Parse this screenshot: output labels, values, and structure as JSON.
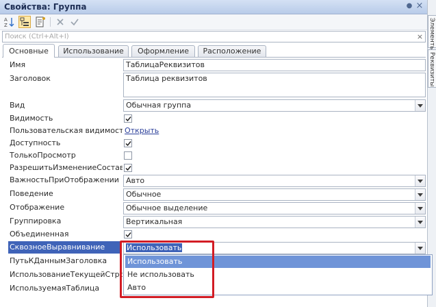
{
  "window": {
    "title": "Свойства: Группа"
  },
  "search": {
    "placeholder": "Поиск (Ctrl+Alt+I)",
    "value": ""
  },
  "tabs": [
    {
      "label": "Основные",
      "active": true
    },
    {
      "label": "Использование",
      "active": false
    },
    {
      "label": "Оформление",
      "active": false
    },
    {
      "label": "Расположение",
      "active": false
    }
  ],
  "props": {
    "name": {
      "label": "Имя",
      "value": "ТаблицаРеквизитов"
    },
    "caption": {
      "label": "Заголовок",
      "value": "Таблица реквизитов"
    },
    "view": {
      "label": "Вид",
      "value": "Обычная группа"
    },
    "visible": {
      "label": "Видимость",
      "checked": true
    },
    "user_visible": {
      "label": "Пользовательская видимость",
      "link": "Открыть"
    },
    "enabled": {
      "label": "Доступность",
      "checked": true
    },
    "readonly": {
      "label": "ТолькоПросмотр",
      "checked": false
    },
    "allow_change": {
      "label": "РазрешитьИзменениеСостава",
      "checked": true
    },
    "importance": {
      "label": "ВажностьПриОтображении",
      "value": "Авто"
    },
    "behavior": {
      "label": "Поведение",
      "value": "Обычное"
    },
    "display": {
      "label": "Отображение",
      "value": "Обычное выделение"
    },
    "grouping": {
      "label": "Группировка",
      "value": "Вертикальная"
    },
    "united": {
      "label": "Объединенная",
      "checked": true
    },
    "through_align": {
      "label": "СквозноеВыравнивание",
      "value": "Использовать"
    },
    "header_path": {
      "label": "ПутьКДаннымЗаголовка"
    },
    "use_current_row": {
      "label": "ИспользованиеТекущейСтроки"
    },
    "used_table": {
      "label": "ИспользуемаяТаблица"
    }
  },
  "dropdown": {
    "options": [
      "Использовать",
      "Не использовать",
      "Авто"
    ],
    "selected_index": 0
  },
  "side": {
    "tab1": "Элементы",
    "tab2": "Реквизиты"
  },
  "colors": {
    "highlight": "#3f63b8",
    "selection": "#6f94d8",
    "annotation": "#d21c24"
  }
}
